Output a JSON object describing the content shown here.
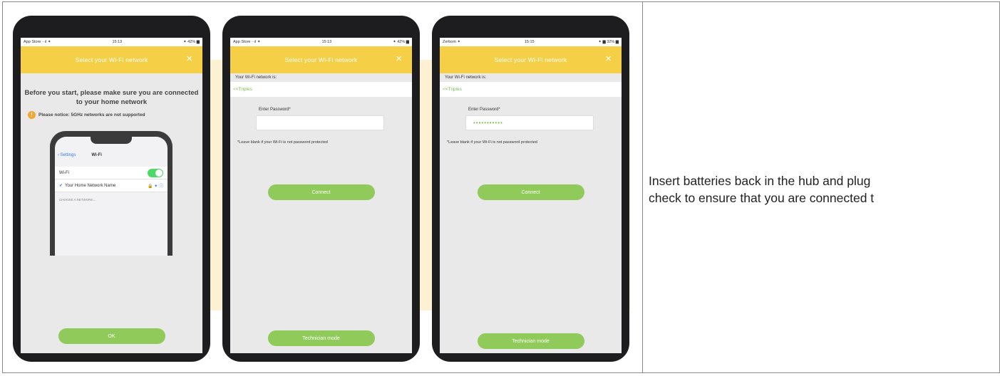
{
  "caption": {
    "line1": "Insert batteries back in the hub and plug",
    "line2": "check to ensure that you are connected t"
  },
  "phones": [
    {
      "status": {
        "left": "App Store ··ıl ✦",
        "center": "15:13",
        "right": "✦ 42% ▆"
      },
      "header_title": "Select your Wi-Fi network",
      "close_icon": "×",
      "heading": "Before you start, please make sure you are connected to your home network",
      "notice_icon": "!",
      "notice": "Please notice: 5GHz networks are not supported",
      "settings_screen": {
        "back": "‹ Settings",
        "title": "Wi-Fi",
        "wifi_label": "Wi-Fi",
        "network_name": "Your Home Network Name",
        "network_icons": "🔒 ✦ ⓘ",
        "section": "CHOOSE A NETWORK..."
      },
      "button": "OK"
    },
    {
      "status": {
        "left": "App Store ··ıl ✦",
        "center": "15:13",
        "right": "✦ 42% ▆"
      },
      "header_title": "Select your Wi-Fi network",
      "close_icon": "×",
      "network_label": "Your Wi-Fi network is:",
      "network_name": "<<Triples",
      "password_label": "Enter Password*",
      "password_value": "",
      "hint": "*Leave blank if your Wi-Fi is not password protected",
      "connect_button": "Connect",
      "mode_button": "Technician mode"
    },
    {
      "status": {
        "left": "Zerbom ✦",
        "center": "15:15",
        "right": "✦ ▆ 32% ▆"
      },
      "header_title": "Select your Wi-Fi network",
      "close_icon": "×",
      "network_label": "Your Wi-Fi network is:",
      "network_name": "<<Triples",
      "password_label": "Enter Password*",
      "password_value": "•••••••••••",
      "hint": "*Leave blank if your Wi-Fi is not password protected",
      "connect_button": "Connect",
      "mode_button": "Technician mode"
    }
  ],
  "colors": {
    "header_yellow": "#f5cf45",
    "button_green": "#8fca5a",
    "backdrop": "#fdf1d3",
    "phone_body": "#1d1d1f"
  }
}
